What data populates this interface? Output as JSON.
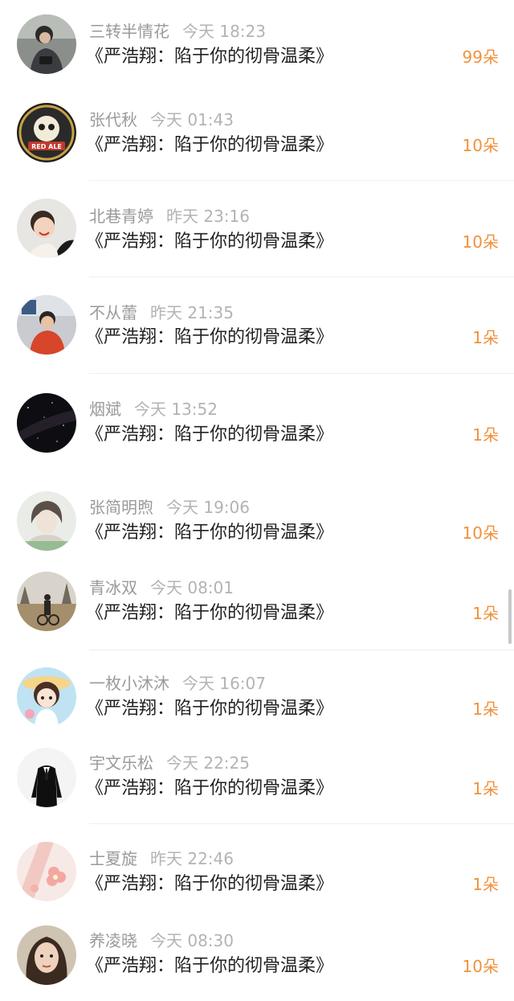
{
  "items": [
    {
      "name": "三转半情花",
      "time": "今天 18:23",
      "title": "《严浩翔：陷于你的彻骨温柔》",
      "count": "99朵",
      "avatar": "photo-person-icon"
    },
    {
      "name": "张代秋",
      "time": "今天 01:43",
      "title": "《严浩翔：陷于你的彻骨温柔》",
      "count": "10朵",
      "avatar": "skull-logo-icon",
      "avatar_text": "RED ALE"
    },
    {
      "name": "北巷青婷",
      "time": "昨天 23:16",
      "title": "《严浩翔：陷于你的彻骨温柔》",
      "count": "10朵",
      "avatar": "photo-child-icon"
    },
    {
      "name": "不从蕾",
      "time": "昨天 21:35",
      "title": "《严浩翔：陷于你的彻骨温柔》",
      "count": "1朵",
      "avatar": "photo-child-icon"
    },
    {
      "name": "烟斌",
      "time": "今天 13:52",
      "title": "《严浩翔：陷于你的彻骨温柔》",
      "count": "1朵",
      "avatar": "starry-sky-icon"
    },
    {
      "name": "张简明煦",
      "time": "今天 19:06",
      "title": "《严浩翔：陷于你的彻骨温柔》",
      "count": "10朵",
      "avatar": "photo-person-icon"
    },
    {
      "name": "青冰双",
      "time": "今天 08:01",
      "title": "《严浩翔：陷于你的彻骨温柔》",
      "count": "1朵",
      "avatar": "photo-landscape-icon"
    },
    {
      "name": "一枚小沐沐",
      "time": "今天 16:07",
      "title": "《严浩翔：陷于你的彻骨温柔》",
      "count": "1朵",
      "avatar": "cartoon-girl-icon"
    },
    {
      "name": "宇文乐松",
      "time": "今天 22:25",
      "title": "《严浩翔：陷于你的彻骨温柔》",
      "count": "1朵",
      "avatar": "suit-figure-icon"
    },
    {
      "name": "士夏旋",
      "time": "昨天 22:46",
      "title": "《严浩翔：陷于你的彻骨温柔》",
      "count": "1朵",
      "avatar": "flower-icon"
    },
    {
      "name": "养凌晓",
      "time": "今天 08:30",
      "title": "《严浩翔：陷于你的彻骨温柔》",
      "count": "10朵",
      "avatar": "photo-person-icon"
    }
  ]
}
